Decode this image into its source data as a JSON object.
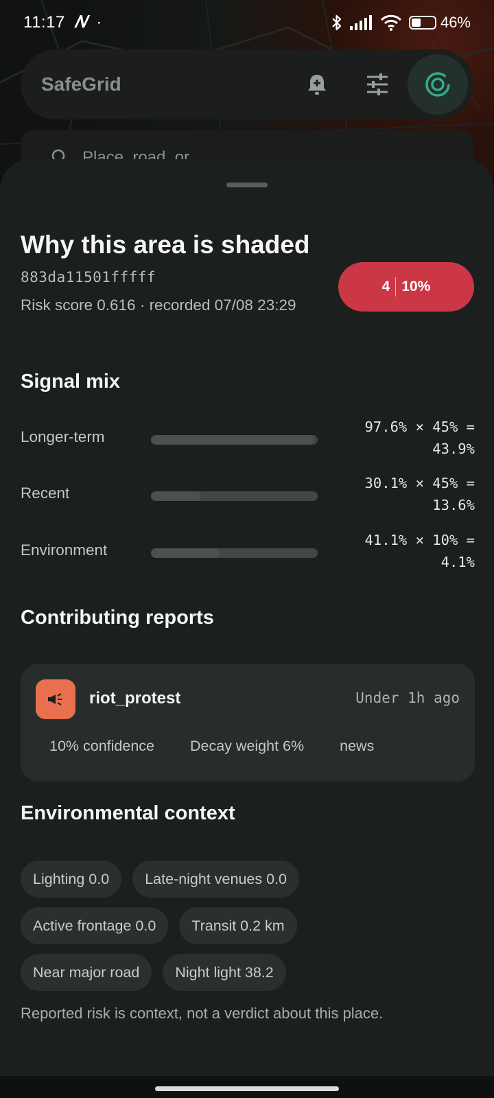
{
  "status_bar": {
    "time": "11:17",
    "carrier_glyph": "𝑁",
    "dot": "·",
    "battery_text": "46%",
    "battery_level": 0.46,
    "icons": [
      "bluetooth-icon",
      "signal-icon",
      "wifi-icon",
      "battery-icon"
    ]
  },
  "app_bar": {
    "title": "SafeGrid",
    "icons": [
      "bell-plus-icon",
      "sliders-icon",
      "radar-icon"
    ]
  },
  "search": {
    "placeholder": "Place, road, or ..."
  },
  "sheet": {
    "title": "Why this area is shaded",
    "cell_id": "883da11501fffff",
    "meta": "Risk score 0.616 · recorded 07/08 23:29",
    "badge": {
      "level": "4",
      "percent": "10%",
      "color": "#cc3746"
    }
  },
  "signal_mix": {
    "heading": "Signal mix",
    "rows": [
      {
        "label": "Longer-term",
        "value": "97.6% × 45% =\n43.9%",
        "fill": 0.976
      },
      {
        "label": "Recent",
        "value": "30.1% × 45% =\n13.6%",
        "fill": 0.301
      },
      {
        "label": "Environment",
        "value": "41.1% × 10% =\n4.1%",
        "fill": 0.411
      }
    ]
  },
  "contributing_reports": {
    "heading": "Contributing reports",
    "items": [
      {
        "category": "riot_protest",
        "icon": "megaphone-icon",
        "icon_color": "#e8704f",
        "age": "Under 1h ago",
        "confidence": "10% confidence",
        "decay": "Decay weight 6%",
        "source": "news"
      }
    ]
  },
  "environmental_context": {
    "heading": "Environmental context",
    "chips": [
      [
        "Lighting 0.0",
        "Late-night venues 0.0"
      ],
      [
        "Active frontage 0.0",
        "Transit 0.2 km"
      ],
      [
        "Near major road",
        "Night light 38.2"
      ]
    ]
  },
  "footnote": "Reported risk is context, not a verdict about this place."
}
